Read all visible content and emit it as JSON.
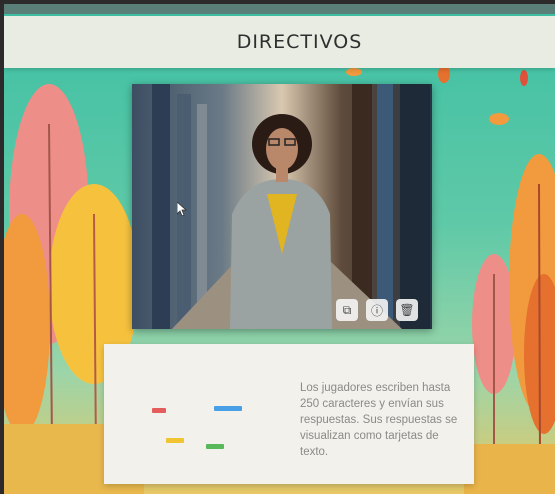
{
  "header": {
    "title": "DIRECTIVOS"
  },
  "photo": {
    "alt": "Portrait of a smiling woman in a grey checked blazer standing in a corridor",
    "actions": [
      {
        "name": "crop-button",
        "icon": "crop-icon",
        "glyph": "⧉"
      },
      {
        "name": "info-button",
        "icon": "info-icon",
        "glyph": "ⓘ"
      },
      {
        "name": "delete-button",
        "icon": "trash-icon",
        "glyph": "🗑"
      }
    ]
  },
  "description": {
    "text": "Los jugadores escriben hasta 250 caracteres y envían sus respuestas. Sus respuestas se visualizan como tarjetas de texto."
  },
  "colors": {
    "background": "#3ec0a4",
    "header": "#e9ece3",
    "card": "#f2f1ec",
    "tree_orange": "#f19a3e",
    "tree_pink": "#ee8e88",
    "tree_yellow": "#f6c23e"
  }
}
